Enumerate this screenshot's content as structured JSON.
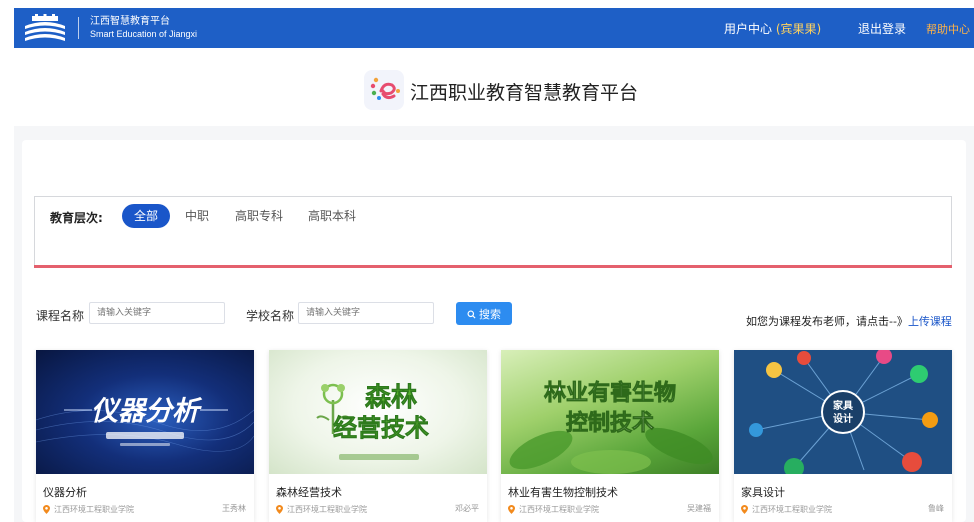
{
  "header": {
    "brand_cn": "江西智慧教育平台",
    "brand_en": "Smart Education of Jiangxi",
    "user_center": "用户中心",
    "user_name": "(宾果果)",
    "logout": "退出登录",
    "help": "帮助中心"
  },
  "site": {
    "title": "江西职业教育智慧教育平台"
  },
  "filter": {
    "label": "教育层次:",
    "options": [
      "全部",
      "中职",
      "高职专科",
      "高职本科"
    ],
    "selected": "全部"
  },
  "search": {
    "course_label": "课程名称",
    "course_placeholder": "请输入关键字",
    "school_label": "学校名称",
    "school_placeholder": "请输入关键字",
    "button": "搜索",
    "upload_prompt": "如您为课程发布老师，请点击--》",
    "upload_link": "上传课程"
  },
  "courses": [
    {
      "name": "仪器分析",
      "school": "江西环境工程职业学院",
      "teacher": "王秀林",
      "thumb_text": "仪器分析"
    },
    {
      "name": "森林经营技术",
      "school": "江西环境工程职业学院",
      "teacher": "邓必平",
      "thumb_text_1": "森林",
      "thumb_text_2": "经营技术"
    },
    {
      "name": "林业有害生物控制技术",
      "school": "江西环境工程职业学院",
      "teacher": "吴建福",
      "thumb_text_1": "林业有害生物",
      "thumb_text_2": "控制技术"
    },
    {
      "name": "家具设计",
      "school": "江西环境工程职业学院",
      "teacher": "鲁峰",
      "thumb_text_1": "家具",
      "thumb_text_2": "设计"
    }
  ],
  "colors": {
    "topbar": "#1e5fc6",
    "accent": "#1a56c9",
    "filter_line": "#e4606d",
    "search_button": "#2d8cf0"
  }
}
